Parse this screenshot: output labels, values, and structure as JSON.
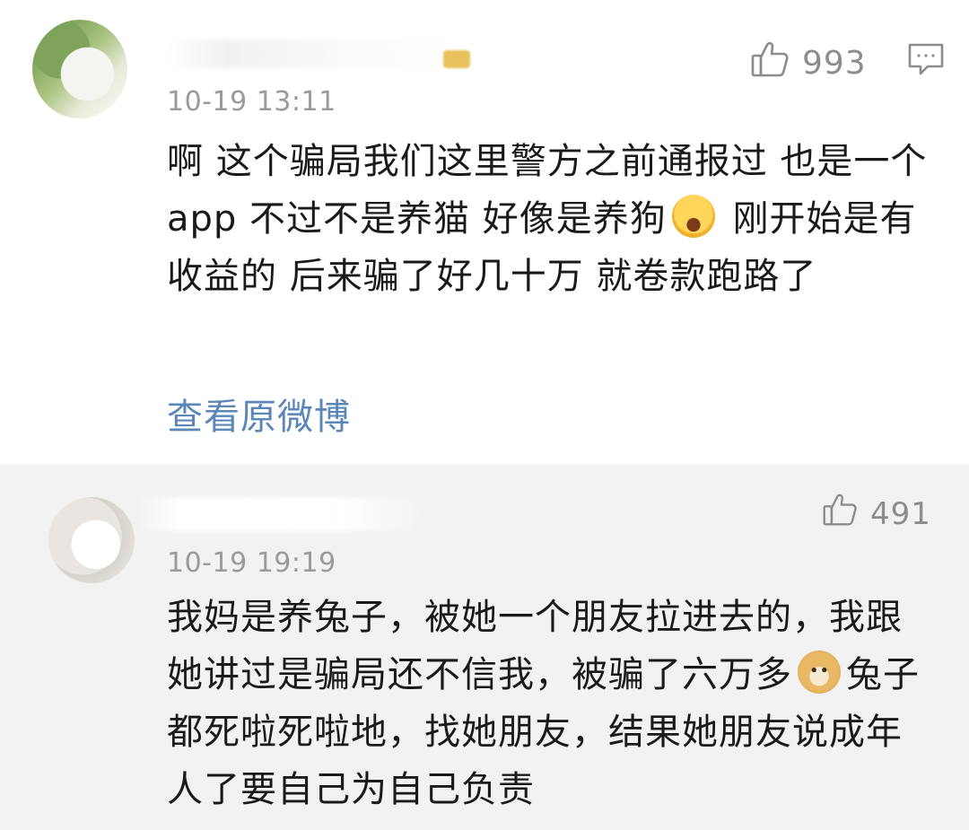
{
  "comments": [
    {
      "time": "10-19 13:11",
      "likes": "993",
      "text_parts": [
        "啊 这个骗局我们这里警方之前通报过  也是一个app  不过不是养猫   好像是养狗",
        " 刚开始是有收益的  后来骗了好几十万   就卷款跑路了"
      ],
      "emoji": "laughing-crying-emoji",
      "view_link": "查看原微博"
    },
    {
      "time": "10-19 19:19",
      "likes": "491",
      "text_parts": [
        "我妈是养兔子，被她一个朋友拉进去的，我跟她讲过是骗局还不信我，被骗了六万多",
        "兔子都死啦死啦地，找她朋友，结果她朋友说成年人了要自己为自己负责"
      ],
      "emoji": "doge-emoji"
    }
  ],
  "colors": {
    "link": "#5b86b8",
    "meta": "#9a9a9a",
    "second_bg": "#f2f2f2"
  }
}
